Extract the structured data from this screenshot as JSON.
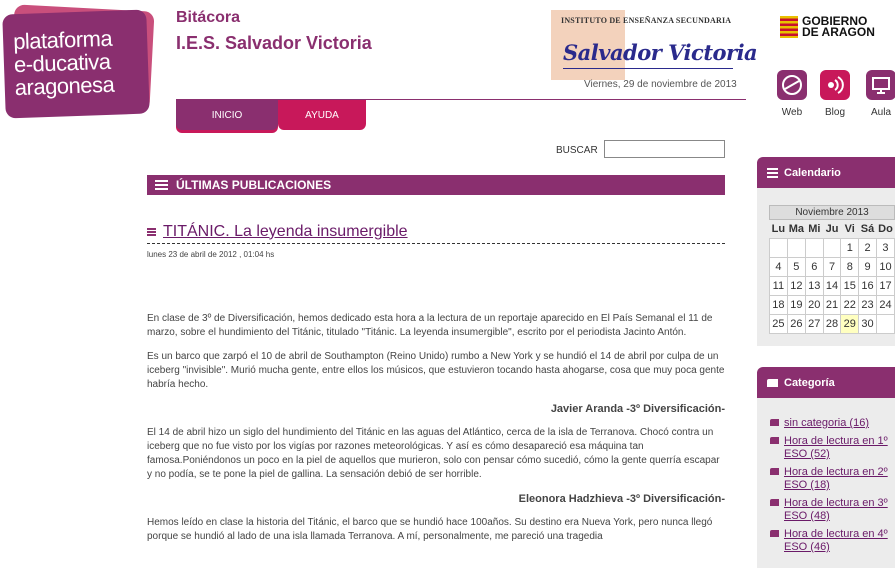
{
  "logo": {
    "line1": "plataforma",
    "line2": "e-ducativa",
    "line3": "aragonesa"
  },
  "site": {
    "subtitle": "Bitácora",
    "title": "I.E.S. Salvador Victoria"
  },
  "school_logo": {
    "institute": "INSTITUTO DE ENSEÑANZA SECUNDARIA",
    "name": "Salvador Victoria"
  },
  "date": "Viernes, 29 de noviembre de 2013",
  "gov": {
    "line1": "GOBIERNO",
    "line2": "DE ARAGON"
  },
  "right_icons": [
    {
      "label": "Web",
      "color": "#8a2f6f"
    },
    {
      "label": "Blog",
      "color": "#c8185a"
    },
    {
      "label": "Aula",
      "color": "#8a2f6f"
    }
  ],
  "nav": {
    "home": "INICIO",
    "help": "AYUDA"
  },
  "search": {
    "label": "BUSCAR",
    "value": ""
  },
  "section": {
    "title": "ÚLTIMAS PUBLICACIONES"
  },
  "post": {
    "title": "TITÁNIC. La leyenda insumergible",
    "date": "lunes 23 de abril de 2012 , 01:04 hs",
    "p1": "En clase de 3º de Diversificación, hemos dedicado esta hora a la lectura de un reportaje aparecido en El País Semanal el 11 de marzo, sobre el hundimiento del Titánic, titulado \"Titánic. La leyenda insumergible\", escrito por el periodista Jacinto Antón.",
    "p2": "Es un barco que zarpó el 10 de abril de Southampton (Reino Unido) rumbo a New York y se hundió el 14 de abril por culpa de un iceberg \"invisible\". Murió mucha gente, entre ellos los músicos, que estuvieron tocando hasta ahogarse, cosa que muy poca gente habría hecho.",
    "author1": "Javier Aranda -3º Diversificación-",
    "p3": "El 14 de abril hizo un siglo del hundimiento del Titánic en las aguas del Atlántico, cerca de la isla de Terranova. Chocó contra un iceberg que no fue visto por los vigías por razones meteorológicas. Y así es cómo desapareció esa máquina tan famosa.Poniéndonos un poco en la piel de aquellos que murieron, solo con pensar cómo sucedió, cómo la gente querría escapar y no podía, se te pone la piel de gallina. La sensación debió de ser horrible.",
    "author2": "Eleonora Hadzhieva -3º Diversificación-",
    "p4": "Hemos leído en clase la historia del Titánic, el barco que se hundió hace 100años. Su destino era Nueva York, pero nunca llegó porque se hundió al lado de una isla llamada Terranova. A mí, personalmente, me pareció una tragedia"
  },
  "calendar": {
    "title": "Calendario",
    "month": "Noviembre 2013",
    "days": [
      "Lu",
      "Ma",
      "Mi",
      "Ju",
      "Vi",
      "Sá",
      "Do"
    ],
    "weeks": [
      [
        "",
        "",
        "",
        "",
        "1",
        "2",
        "3"
      ],
      [
        "4",
        "5",
        "6",
        "7",
        "8",
        "9",
        "10"
      ],
      [
        "11",
        "12",
        "13",
        "14",
        "15",
        "16",
        "17"
      ],
      [
        "18",
        "19",
        "20",
        "21",
        "22",
        "23",
        "24"
      ],
      [
        "25",
        "26",
        "27",
        "28",
        "29",
        "30",
        ""
      ]
    ],
    "today": "29"
  },
  "categories": {
    "title": "Categoría",
    "items": [
      "sin categoria (16)",
      "Hora de lectura en 1º ESO (52)",
      "Hora de lectura en 2º ESO (18)",
      "Hora de lectura en 3º ESO (48)",
      "Hora de lectura en 4º ESO (46)"
    ]
  }
}
